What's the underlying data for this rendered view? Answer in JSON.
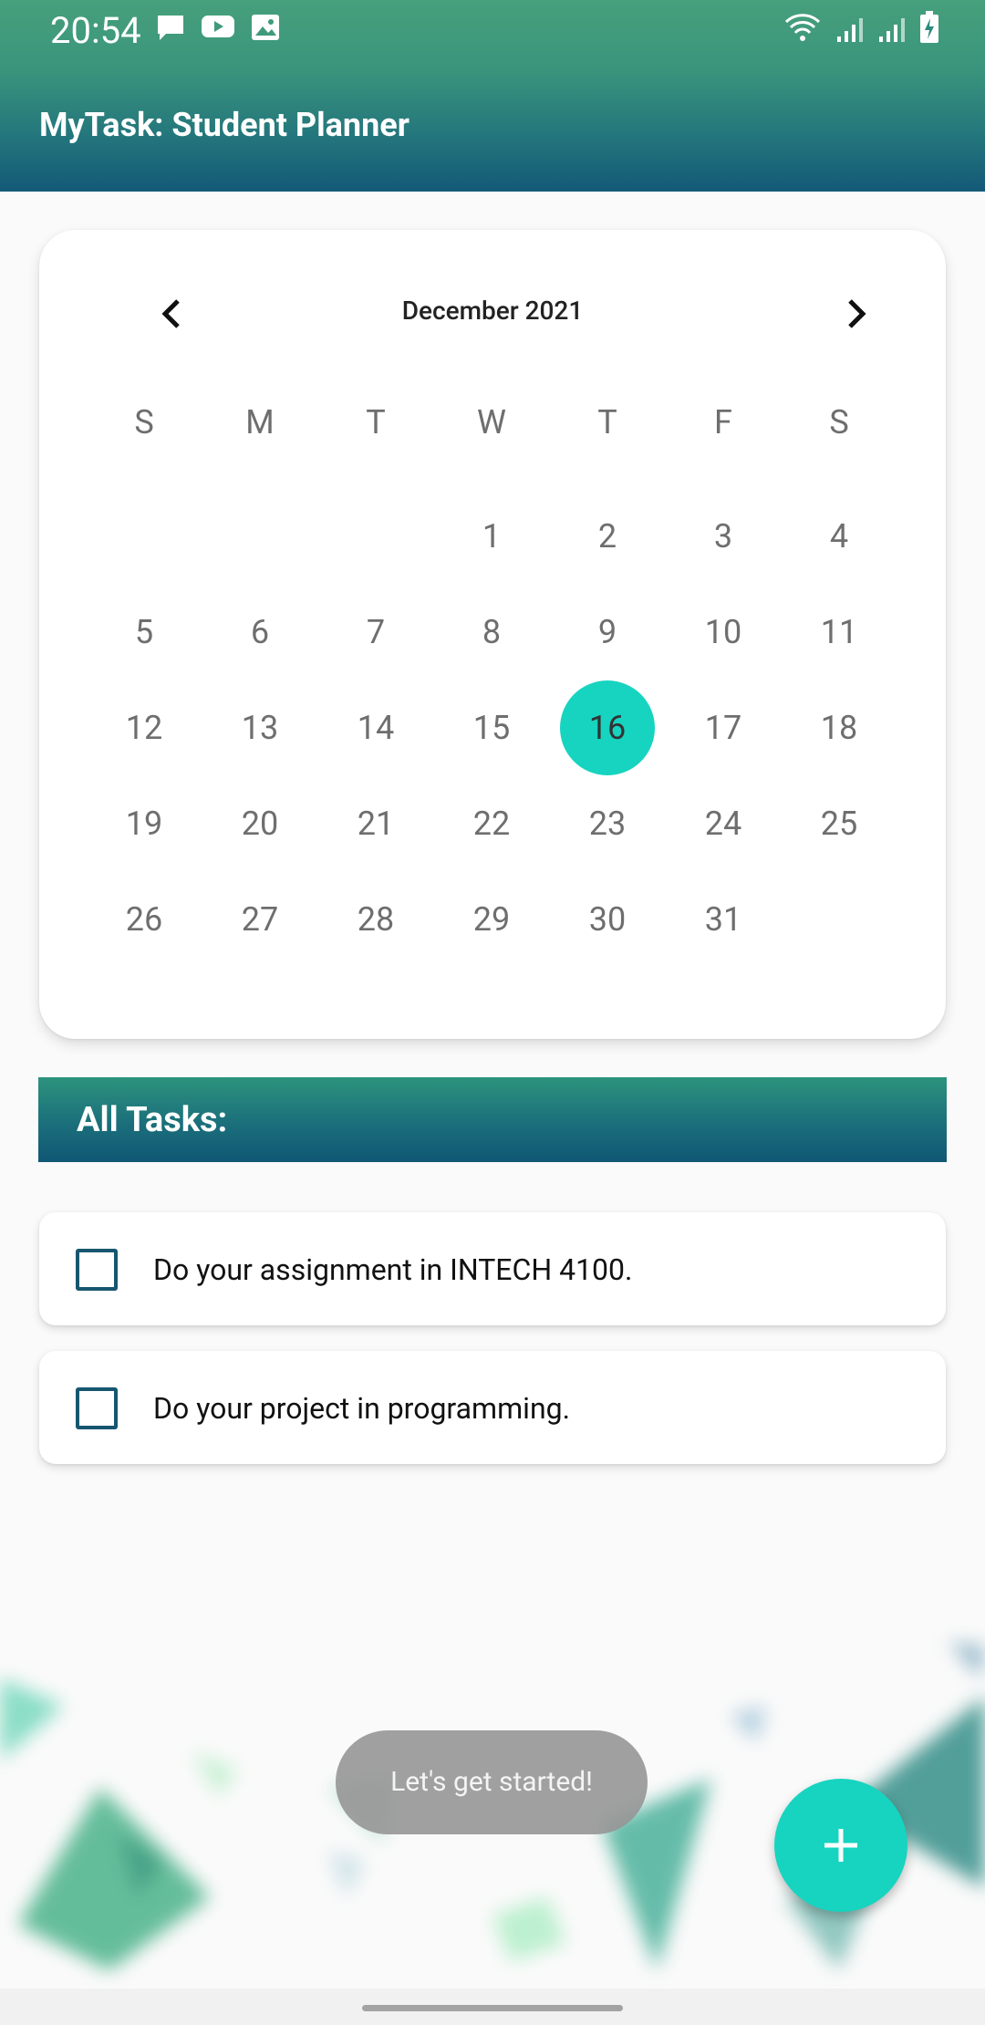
{
  "status_bar": {
    "time": "20:54"
  },
  "app_bar": {
    "title": "MyTask: Student Planner"
  },
  "calendar": {
    "month_label": "December 2021",
    "weekdays": [
      "S",
      "M",
      "T",
      "W",
      "T",
      "F",
      "S"
    ],
    "weeks": [
      [
        "",
        "",
        "",
        "1",
        "2",
        "3",
        "4"
      ],
      [
        "5",
        "6",
        "7",
        "8",
        "9",
        "10",
        "11"
      ],
      [
        "12",
        "13",
        "14",
        "15",
        "16",
        "17",
        "18"
      ],
      [
        "19",
        "20",
        "21",
        "22",
        "23",
        "24",
        "25"
      ],
      [
        "26",
        "27",
        "28",
        "29",
        "30",
        "31",
        ""
      ]
    ],
    "selected_day": "16"
  },
  "tasks": {
    "header": "All Tasks:",
    "items": [
      {
        "text": "Do your assignment in INTECH 4100.",
        "checked": false
      },
      {
        "text": "Do your project in programming.",
        "checked": false
      }
    ]
  },
  "toast": {
    "message": "Let's get started!"
  },
  "fab": {
    "icon": "plus-icon"
  },
  "colors": {
    "header_top": "#46a07c",
    "header_bottom": "#135977",
    "accent": "#16d4c0",
    "checkbox_border": "#16566f"
  }
}
